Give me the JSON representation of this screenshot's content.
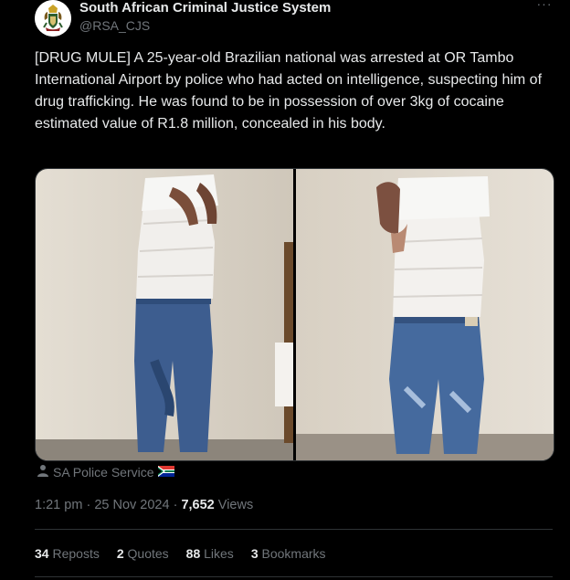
{
  "author": {
    "display_name": "South African Criminal Justice System",
    "handle": "@RSA_CJS"
  },
  "more_label": "···",
  "tweet_text": "[DRUG MULE] A 25-year-old Brazilian national was arrested at OR Tambo International Airport by police who had acted on intelligence, suspecting him of drug trafficking. He was found to be in possession of over 3kg of cocaine estimated value of R1.8 million, concealed in his body.",
  "media_credit": {
    "text": "SA Police Service"
  },
  "timestamp": {
    "time": "1:21 pm",
    "date": "25 Nov 2024",
    "separator": "·",
    "views_count": "7,652",
    "views_label": "Views"
  },
  "stats": [
    {
      "count": "34",
      "label": "Reposts"
    },
    {
      "count": "2",
      "label": "Quotes"
    },
    {
      "count": "88",
      "label": "Likes"
    },
    {
      "count": "3",
      "label": "Bookmarks"
    }
  ],
  "colors": {
    "background": "#000000",
    "primary_text": "#e7e9ea",
    "secondary_text": "#71767b",
    "divider": "#2f3336"
  }
}
